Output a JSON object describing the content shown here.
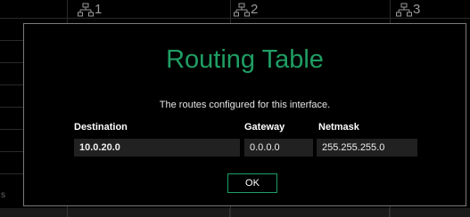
{
  "background": {
    "tabs": [
      {
        "label": "1",
        "icon": "network-icon"
      },
      {
        "label": "2",
        "icon": "network-icon"
      },
      {
        "label": "3",
        "icon": "network-icon"
      }
    ],
    "edge_char": "s"
  },
  "dialog": {
    "title": "Routing Table",
    "description": "The routes configured for this interface.",
    "columns": {
      "destination": "Destination",
      "gateway": "Gateway",
      "netmask": "Netmask"
    },
    "rows": [
      {
        "destination": "10.0.20.0",
        "gateway": "0.0.0.0",
        "netmask": "255.255.255.0"
      }
    ],
    "ok_label": "OK"
  },
  "colors": {
    "accent": "#1f9e63",
    "cell_bg": "#212121",
    "border": "#7a7a7a"
  }
}
